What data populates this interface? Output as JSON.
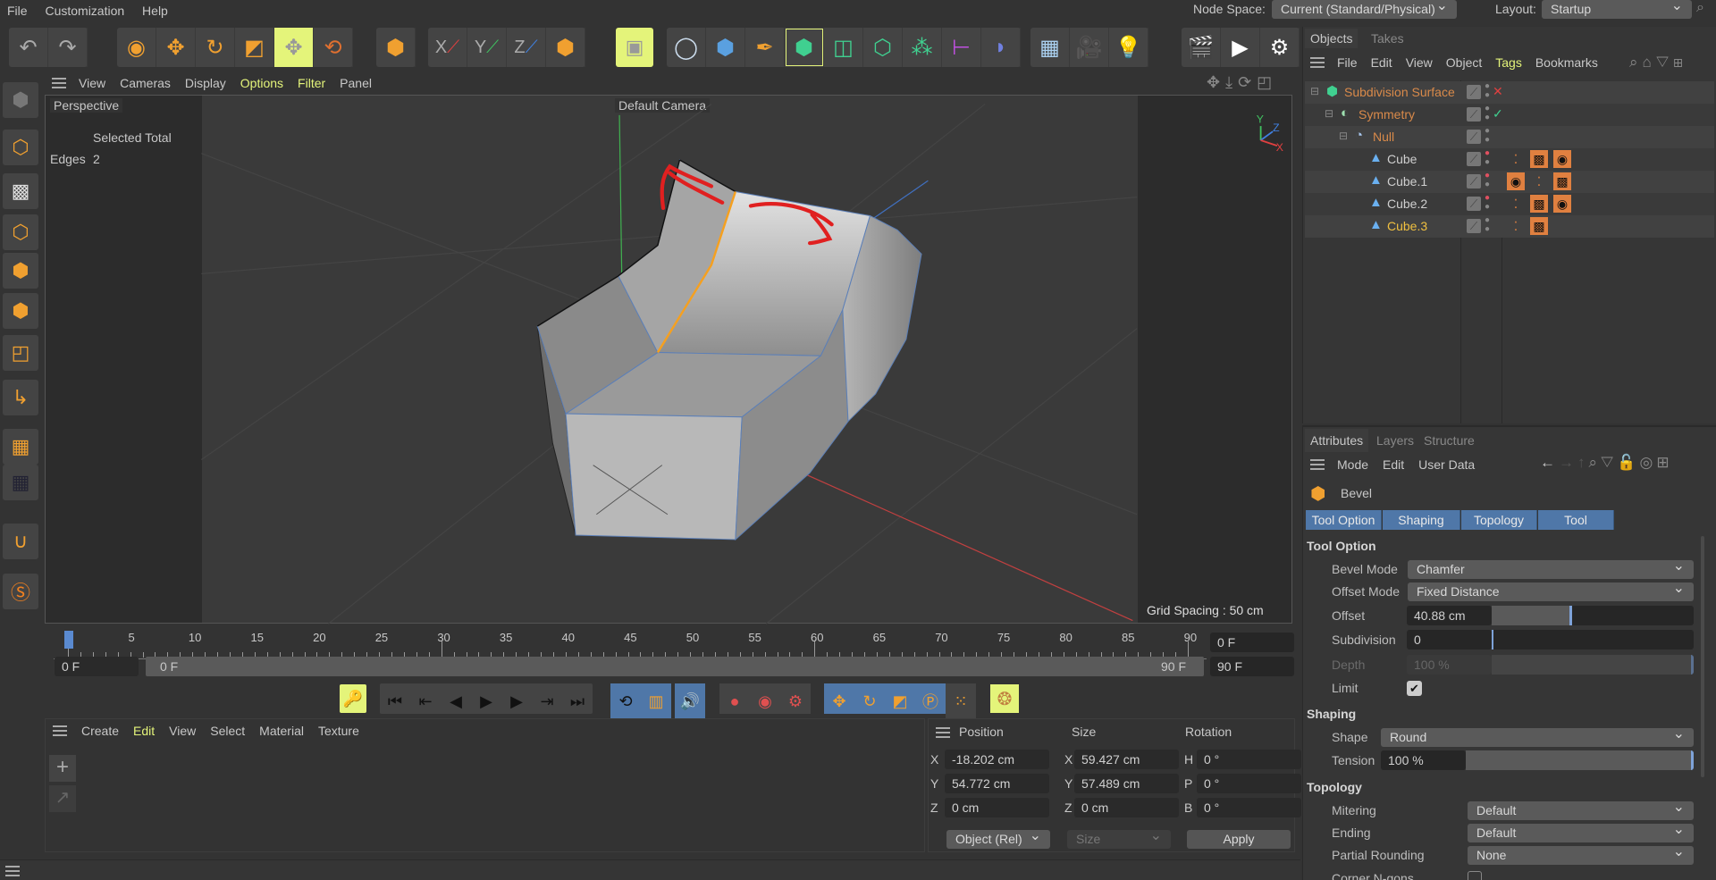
{
  "menubar": {
    "items": [
      "File",
      "Customization",
      "Help"
    ],
    "node_space_label": "Node Space:",
    "node_space_value": "Current (Standard/Physical)",
    "layout_label": "Layout:",
    "layout_value": "Startup"
  },
  "toolbar": {
    "icons": [
      "undo-icon",
      "redo-icon",
      "live-selection-icon",
      "move-icon",
      "rotate-icon",
      "scale-icon",
      "axis-move-icon",
      "transform-icon",
      "object-icon",
      "x-axis-icon",
      "y-axis-icon",
      "z-axis-icon",
      "coordinate-system-icon",
      "render-region-icon",
      "null-icon",
      "cube-icon",
      "pen-icon",
      "subdivision-surface-icon",
      "extrude-icon",
      "volume-icon",
      "cloner-icon",
      "symmetry-icon",
      "bend-icon",
      "floor-icon",
      "camera-icon",
      "light-icon",
      "render-view-icon",
      "render-icon",
      "render-settings-icon"
    ],
    "axis_labels": [
      "X",
      "Y",
      "Z"
    ]
  },
  "viewport": {
    "menu": [
      "View",
      "Cameras",
      "Display",
      "Options",
      "Filter",
      "Panel"
    ],
    "menu_highlight": [
      "Options",
      "Filter"
    ],
    "view_name": "Perspective",
    "camera": "Default Camera",
    "stats_header": "Selected Total",
    "stats_label": "Edges",
    "stats_value": "2",
    "grid_spacing": "Grid Spacing : 50 cm",
    "axis": {
      "x": "X",
      "y": "Y",
      "z": "Z"
    }
  },
  "timeline": {
    "ticks": [
      0,
      5,
      10,
      15,
      20,
      25,
      30,
      35,
      40,
      45,
      50,
      55,
      60,
      65,
      70,
      75,
      80,
      85,
      90
    ],
    "current_frame": 0,
    "start_field": "0 F",
    "range_start": "0 F",
    "range_end": "90 F",
    "current_field": "0 F",
    "end_field": "90 F"
  },
  "materials": {
    "menu": [
      "Create",
      "Edit",
      "View",
      "Select",
      "Material",
      "Texture"
    ],
    "highlight": "Edit"
  },
  "coords": {
    "headers": [
      "Position",
      "Size",
      "Rotation"
    ],
    "rows": [
      {
        "pl": "X",
        "p": "-18.202 cm",
        "sl": "X",
        "s": "59.427 cm",
        "rl": "H",
        "r": "0 °"
      },
      {
        "pl": "Y",
        "p": "54.772 cm",
        "sl": "Y",
        "s": "57.489 cm",
        "rl": "P",
        "r": "0 °"
      },
      {
        "pl": "Z",
        "p": "0 cm",
        "sl": "Z",
        "s": "0 cm",
        "rl": "B",
        "r": "0 °"
      }
    ],
    "mode": "Object (Rel)",
    "size_mode": "Size",
    "apply": "Apply"
  },
  "objects": {
    "tabs": [
      "Objects",
      "Takes"
    ],
    "menu": [
      "File",
      "Edit",
      "View",
      "Object",
      "Tags",
      "Bookmarks"
    ],
    "items": [
      {
        "name": "Subdivision Surface",
        "color": "#d98a4a",
        "status": "✕"
      },
      {
        "name": "Symmetry",
        "color": "#d98a4a",
        "status": "✓"
      },
      {
        "name": "Null",
        "color": "#d98a4a",
        "status": ""
      },
      {
        "name": "Cube",
        "color": "#cfcfcf",
        "status": ""
      },
      {
        "name": "Cube.1",
        "color": "#cfcfcf",
        "status": ""
      },
      {
        "name": "Cube.2",
        "color": "#cfcfcf",
        "status": ""
      },
      {
        "name": "Cube.3",
        "color": "#f0c040",
        "status": ""
      }
    ]
  },
  "attributes": {
    "tabs": [
      "Attributes",
      "Layers",
      "Structure"
    ],
    "menu": [
      "Mode",
      "Edit",
      "User Data"
    ],
    "tool": "Bevel",
    "subtabs": [
      "Tool Option",
      "Shaping",
      "Topology",
      "Tool"
    ],
    "tool_option": {
      "title": "Tool Option",
      "bevel_mode_label": "Bevel Mode",
      "bevel_mode": "Chamfer",
      "offset_mode_label": "Offset Mode",
      "offset_mode": "Fixed Distance",
      "offset_label": "Offset",
      "offset": "40.88 cm",
      "offset_fraction": 0.4,
      "subdivision_label": "Subdivision",
      "subdivision": "0",
      "depth_label": "Depth",
      "depth": "100 %",
      "limit_label": "Limit",
      "limit": true
    },
    "shaping": {
      "title": "Shaping",
      "shape_label": "Shape",
      "shape": "Round",
      "tension_label": "Tension",
      "tension": "100 %"
    },
    "topology": {
      "title": "Topology",
      "mitering_label": "Mitering",
      "mitering": "Default",
      "ending_label": "Ending",
      "ending": "Default",
      "partial_label": "Partial Rounding",
      "partial": "None",
      "corner_label": "Corner N-gons"
    }
  },
  "colors": {
    "accent": "#f0a030",
    "highlight": "#e4f47a",
    "tab_blue": "#4f77a8",
    "selected_edge": "#f5a020",
    "annotation": "#e02020"
  }
}
